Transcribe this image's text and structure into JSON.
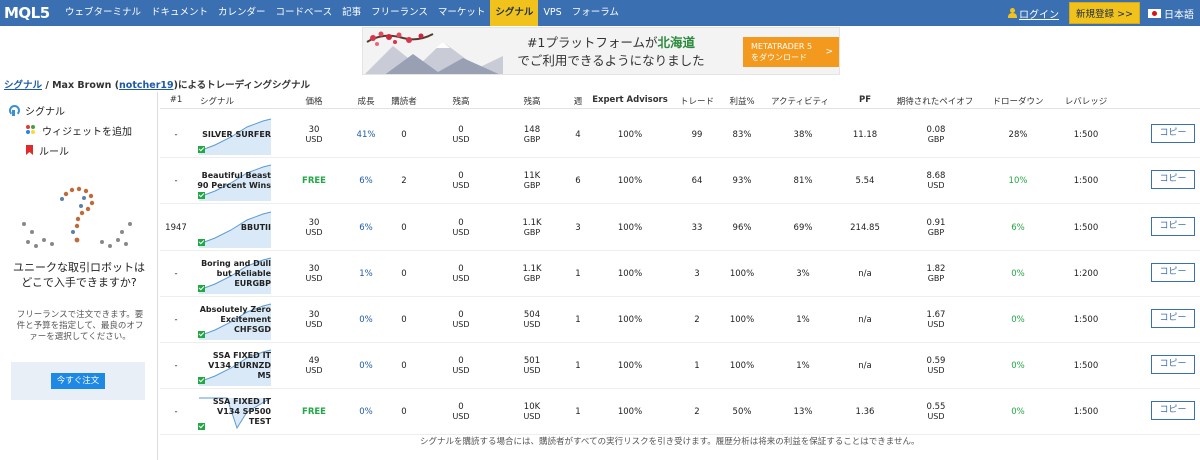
{
  "header": {
    "logo": "MQL5",
    "nav": [
      "ウェブターミナル",
      "ドキュメント",
      "カレンダー",
      "コードベース",
      "記事",
      "フリーランス",
      "マーケット",
      "シグナル",
      "VPS",
      "フォーラム"
    ],
    "active_index": 7,
    "login": "ログイン",
    "register": "新規登録 >>",
    "language": "日本語"
  },
  "banner": {
    "line1_prefix": "#1プラットフォームが",
    "line1_highlight": "北海道",
    "line2": "でご利用できるようになりました",
    "button_line1": "METATRADER 5",
    "button_line2": "をダウンロード",
    "button_arrow": ">"
  },
  "breadcrumb": {
    "root": "シグナル",
    "sep": " / Max Brown (",
    "user": "notcher19",
    "suffix": ")によるトレーディングシグナル"
  },
  "sidebar": {
    "items": [
      "シグナル",
      "ウィジェットを追加",
      "ルール"
    ],
    "promo_title": "ユニークな取引ロボットはどこで入手できますか?",
    "promo_text": "フリーランスで注文できます。要件と予算を指定して、最良のオファーを選択してください。",
    "promo_button": "今すぐ注文"
  },
  "table": {
    "headers": [
      "#1",
      "シグナル",
      "価格",
      "成長",
      "購読者",
      "残高",
      "残高",
      "週",
      "Expert Advisors",
      "トレード",
      "利益%",
      "アクティビティ",
      "PF",
      "期待されたペイオフ",
      "ドローダウン",
      "レバレッジ"
    ],
    "copy_label": "コピー",
    "rows": [
      {
        "rank": "-",
        "name": "SILVER SURFER",
        "price": "30",
        "price_unit": "USD",
        "growth": "41%",
        "subs": "0",
        "funds": "0",
        "funds_unit": "USD",
        "balance": "148",
        "balance_unit": "GBP",
        "weeks": "4",
        "ea": "100%",
        "trades": "99",
        "profit": "83%",
        "activity": "38%",
        "pf": "11.18",
        "payoff": "0.08",
        "payoff_unit": "GBP",
        "dd": "28%",
        "leverage": "1:500",
        "chart": "rise"
      },
      {
        "rank": "-",
        "name": "Beautiful Beast 90 Percent Wins",
        "price": "FREE",
        "price_unit": "",
        "growth": "6%",
        "subs": "2",
        "funds": "0",
        "funds_unit": "USD",
        "balance": "11K",
        "balance_unit": "GBP",
        "weeks": "6",
        "ea": "100%",
        "trades": "64",
        "profit": "93%",
        "activity": "81%",
        "pf": "5.54",
        "payoff": "8.68",
        "payoff_unit": "USD",
        "dd": "10%",
        "leverage": "1:500",
        "chart": "rise"
      },
      {
        "rank": "1947",
        "name": "BBUTII",
        "price": "30",
        "price_unit": "USD",
        "growth": "6%",
        "subs": "0",
        "funds": "0",
        "funds_unit": "USD",
        "balance": "1.1K",
        "balance_unit": "GBP",
        "weeks": "3",
        "ea": "100%",
        "trades": "33",
        "profit": "96%",
        "activity": "69%",
        "pf": "214.85",
        "payoff": "0.91",
        "payoff_unit": "GBP",
        "dd": "6%",
        "leverage": "1:500",
        "chart": "rise"
      },
      {
        "rank": "-",
        "name": "Boring and Dull but Reliable EURGBP",
        "price": "30",
        "price_unit": "USD",
        "growth": "1%",
        "subs": "0",
        "funds": "0",
        "funds_unit": "USD",
        "balance": "1.1K",
        "balance_unit": "GBP",
        "weeks": "1",
        "ea": "100%",
        "trades": "3",
        "profit": "100%",
        "activity": "3%",
        "pf": "n/a",
        "payoff": "1.82",
        "payoff_unit": "GBP",
        "dd": "0%",
        "leverage": "1:200",
        "chart": "rise"
      },
      {
        "rank": "-",
        "name": "Absolutely Zero Excitement CHFSGD",
        "price": "30",
        "price_unit": "USD",
        "growth": "0%",
        "subs": "0",
        "funds": "0",
        "funds_unit": "USD",
        "balance": "504",
        "balance_unit": "USD",
        "weeks": "1",
        "ea": "100%",
        "trades": "2",
        "profit": "100%",
        "activity": "1%",
        "pf": "n/a",
        "payoff": "1.67",
        "payoff_unit": "USD",
        "dd": "0%",
        "leverage": "1:500",
        "chart": "rise"
      },
      {
        "rank": "-",
        "name": "SSA FIXED IT V134 EURNZD M5",
        "price": "49",
        "price_unit": "USD",
        "growth": "0%",
        "subs": "0",
        "funds": "0",
        "funds_unit": "USD",
        "balance": "501",
        "balance_unit": "USD",
        "weeks": "1",
        "ea": "100%",
        "trades": "1",
        "profit": "100%",
        "activity": "1%",
        "pf": "n/a",
        "payoff": "0.59",
        "payoff_unit": "USD",
        "dd": "0%",
        "leverage": "1:500",
        "chart": "rise"
      },
      {
        "rank": "-",
        "name": "SSA FIXED IT V134 SP500 TEST",
        "price": "FREE",
        "price_unit": "",
        "growth": "0%",
        "subs": "0",
        "funds": "0",
        "funds_unit": "USD",
        "balance": "10K",
        "balance_unit": "USD",
        "weeks": "1",
        "ea": "100%",
        "trades": "2",
        "profit": "50%",
        "activity": "13%",
        "pf": "1.36",
        "payoff": "0.55",
        "payoff_unit": "USD",
        "dd": "0%",
        "leverage": "1:500",
        "chart": "dip"
      }
    ]
  },
  "footnote": "シグナルを購読する場合には、購読者がすべての実行リスクを引き受けます。履歴分析は将来の利益を保証することはできません。",
  "colors": {
    "nav_bg": "#3a6fb1",
    "active": "#f1c21b",
    "green": "#22a745",
    "link": "#1d5aa8",
    "orange": "#f39a1e"
  }
}
